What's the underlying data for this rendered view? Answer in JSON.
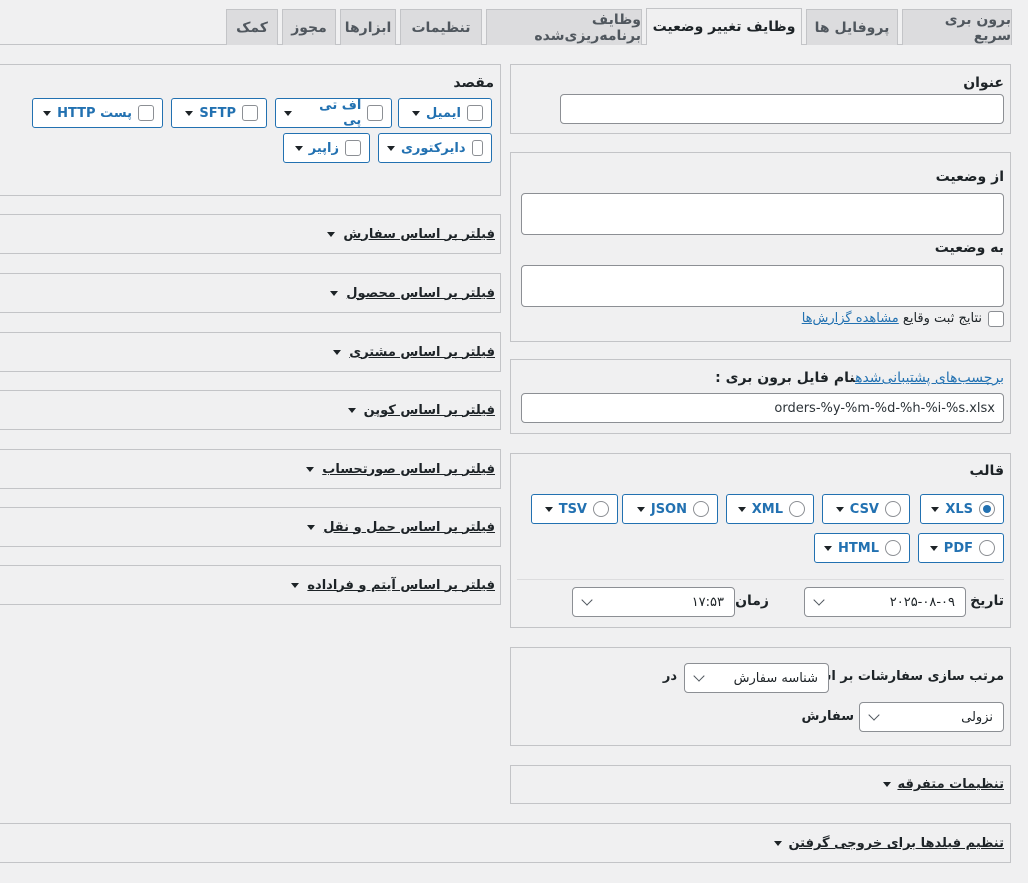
{
  "tabs": [
    {
      "label": "برون بری سریع",
      "active": false
    },
    {
      "label": "پروفایل ها",
      "active": false
    },
    {
      "label": "وظایف تغییر وضعیت",
      "active": true
    },
    {
      "label": "وظایف برنامه‌ریزی‌شده",
      "active": false
    },
    {
      "label": "تنظیمات",
      "active": false
    },
    {
      "label": "ابزارها",
      "active": false
    },
    {
      "label": "مجوز",
      "active": false
    },
    {
      "label": "کمک",
      "active": false
    }
  ],
  "title_section": {
    "label": "عنوان",
    "value": ""
  },
  "status_section": {
    "from_label": "از وضعیت",
    "to_label": "به وضعیت",
    "log_label": "نتایج ثبت وقایع",
    "log_link": "مشاهده گزارش‌ها"
  },
  "filename_section": {
    "tags_link": "برچسب‌های پشتیبانی‌شده",
    "label": "نام فایل برون بری :",
    "value": "orders-%y-%m-%d-%h-%i-%s.xlsx"
  },
  "format_section": {
    "label": "قالب",
    "formats": [
      "XLS",
      "CSV",
      "XML",
      "JSON",
      "TSV",
      "PDF",
      "HTML"
    ],
    "selected": "XLS",
    "date_label": "تاریخ",
    "date_value": "۲۰۲۵-۰۸-۰۹",
    "time_label": "زمان",
    "time_value": "۱۷:۵۳"
  },
  "sort_section": {
    "label": "مرتب سازی سفارشات بر اساس",
    "field_value": "شناسه سفارش",
    "in_label": "در",
    "direction_value": "نزولی",
    "orders_label": "سفارش"
  },
  "misc_section": {
    "label": "تنظیمات متفرقه"
  },
  "fields_section": {
    "label": "تنظیم فیلدها برای خروجی گرفتن"
  },
  "destination": {
    "label": "مقصد",
    "options": [
      "ایمیل",
      "اف تی پی",
      "SFTP",
      "پست HTTP",
      "دایرکتوری",
      "زاپیر"
    ]
  },
  "filters": [
    "فیلتر بر اساس سفارش",
    "فیلتر بر اساس محصول",
    "فیلتر بر اساس مشتری",
    "فیلتر بر اساس کوپن",
    "فیلتر بر اساس صورتحساب",
    "فیلتر بر اساس حمل و نقل",
    "فیلتر بر اساس آیتم و فراداده"
  ]
}
